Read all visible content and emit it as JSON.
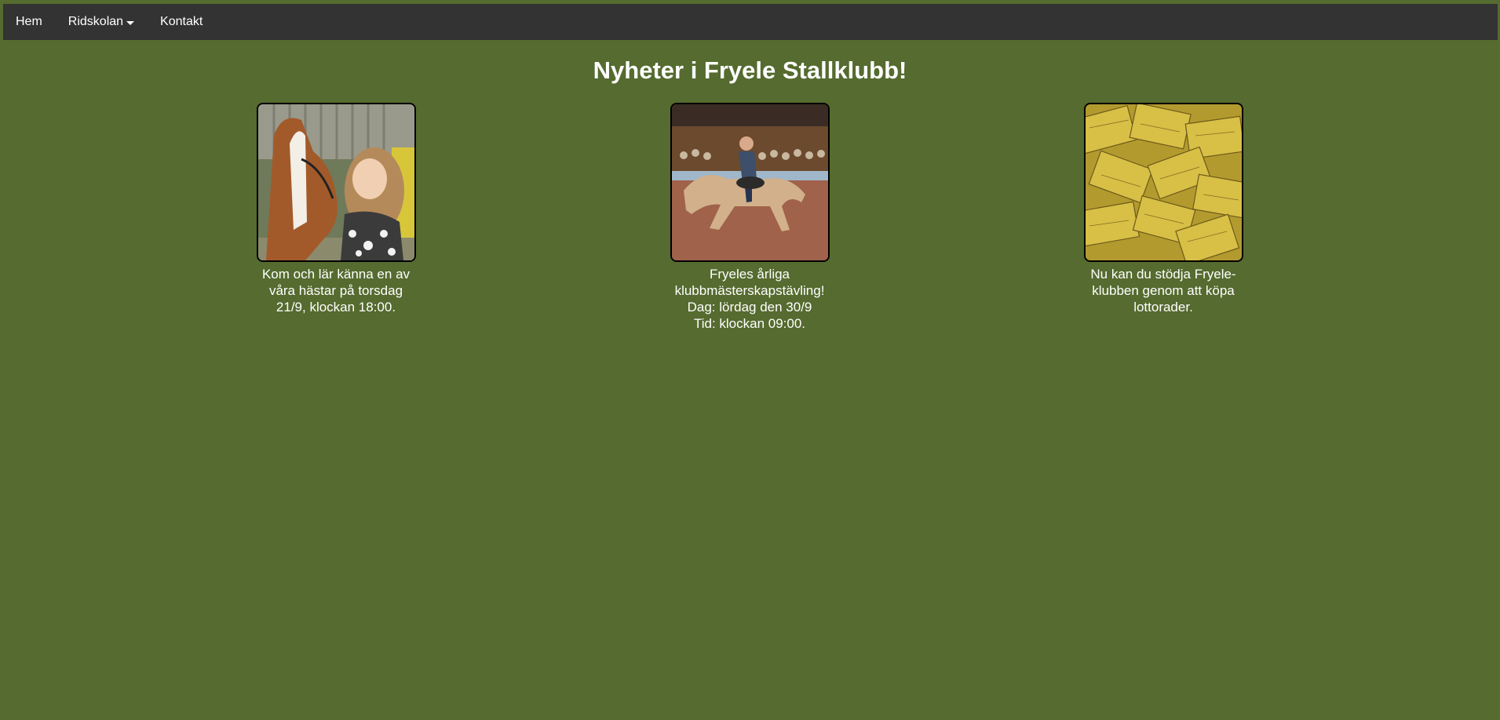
{
  "nav": {
    "items": [
      {
        "label": "Hem"
      },
      {
        "label": "Ridskolan"
      },
      {
        "label": "Kontakt"
      }
    ]
  },
  "page": {
    "title": "Nyheter i Fryele Stallklubb!"
  },
  "news": [
    {
      "image": "girl-with-horse-photo",
      "caption": "Kom och lär känna en av våra hästar på torsdag 21/9, klockan 18:00."
    },
    {
      "image": "barrel-racing-rider-photo",
      "caption_lines": [
        "Fryeles årliga klubbmästerskapstävling!",
        "Dag: lördag den 30/9",
        "Tid: klockan 09:00."
      ]
    },
    {
      "image": "lottery-tickets-photo",
      "caption": "Nu kan du stödja Fryele-klubben genom att köpa lottorader."
    }
  ],
  "colors": {
    "background": "#556b2f",
    "navbar": "#333333",
    "text": "#ffffff"
  }
}
